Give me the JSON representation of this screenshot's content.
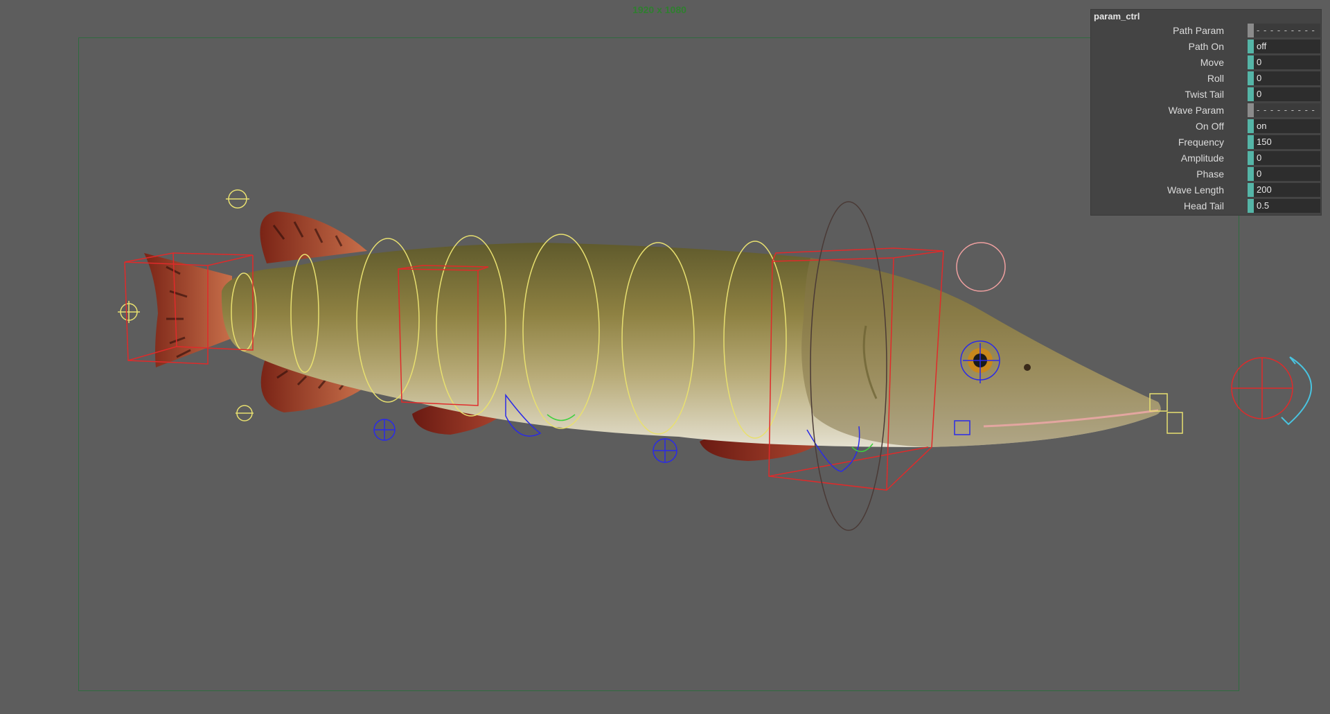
{
  "viewport": {
    "resolution_label": "1920 x 1080",
    "background_color": "#5d5d5d",
    "resolution_gate_color": "#2f6b3f"
  },
  "scene": {
    "object": "pike fish rig",
    "colors": {
      "fish_body": "#9a8a4a",
      "fins": "#a4432a",
      "ik_ctrl": "#e02a2a",
      "fk_ring": "#e8e070",
      "locator": "#2a2ae8",
      "pole": "#3ed13e",
      "pink_ring": "#f0a0a0",
      "cyan_arrow": "#49c4e0"
    }
  },
  "param_panel": {
    "title": "param_ctrl",
    "rows": [
      {
        "label": "Path Param",
        "value": "- - - - - - - - - - - - - -",
        "separator": true
      },
      {
        "label": "Path On",
        "value": "off"
      },
      {
        "label": "Move",
        "value": "0"
      },
      {
        "label": "Roll",
        "value": "0"
      },
      {
        "label": "Twist Tail",
        "value": "0"
      },
      {
        "label": "Wave Param",
        "value": "- - - - - - - - - - - - - -",
        "separator": true
      },
      {
        "label": "On Off",
        "value": "on"
      },
      {
        "label": "Frequency",
        "value": "150"
      },
      {
        "label": "Amplitude",
        "value": "0"
      },
      {
        "label": "Phase",
        "value": "0"
      },
      {
        "label": "Wave Length",
        "value": "200"
      },
      {
        "label": "Head Tail",
        "value": "0.5"
      }
    ]
  }
}
